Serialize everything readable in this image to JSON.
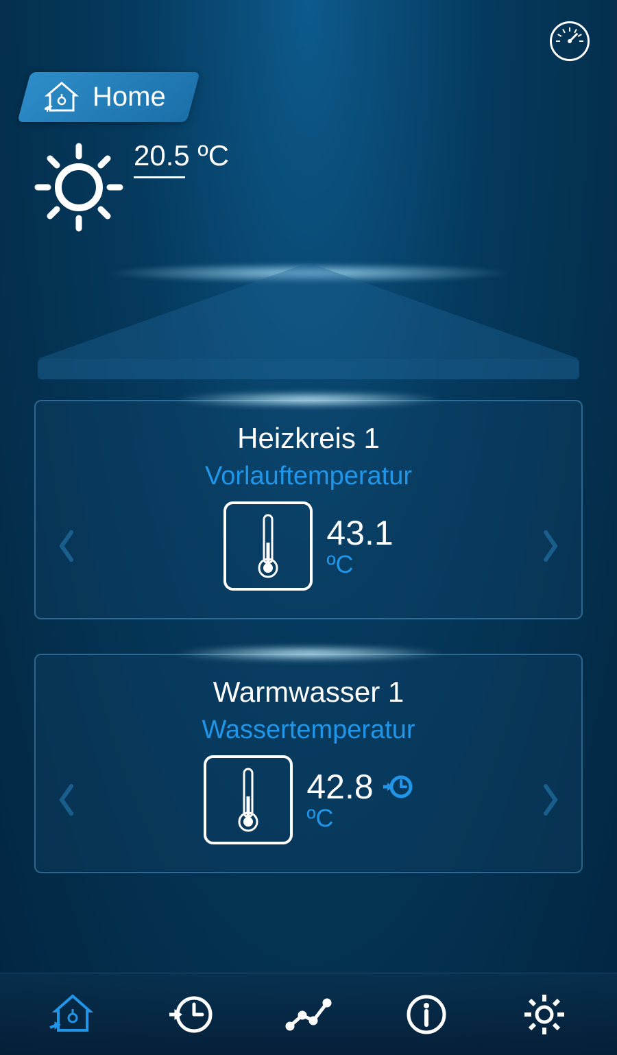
{
  "header": {
    "tab_label": "Home"
  },
  "weather": {
    "outdoor_temp": "20.5",
    "unit": "ºC"
  },
  "cards": [
    {
      "title": "Heizkreis 1",
      "subtitle": "Vorlauftemperatur",
      "value": "43.1",
      "unit": "ºC",
      "has_timer": false
    },
    {
      "title": "Warmwasser 1",
      "subtitle": "Wassertemperatur",
      "value": "42.8",
      "unit": "ºC",
      "has_timer": true
    }
  ],
  "nav": {
    "items": [
      "home",
      "history",
      "chart",
      "info",
      "settings"
    ]
  },
  "colors": {
    "accent": "#2196e8",
    "text": "#ffffff"
  }
}
